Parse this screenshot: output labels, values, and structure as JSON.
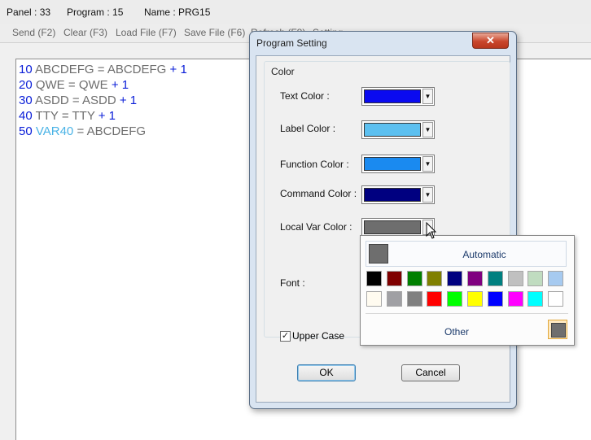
{
  "status": {
    "panel": "Panel : 33",
    "program": "Program : 15",
    "name": "Name : PRG15"
  },
  "toolbar": {
    "send": "Send (F2)",
    "clear": "Clear (F3)",
    "load": "Load File (F7)",
    "save": "Save File (F6)",
    "refresh": "Refresh (F8)",
    "setting": "Setting"
  },
  "code": {
    "line1": {
      "num": "10",
      "var": "ABCDEFG",
      "eq": "=",
      "val": "ABCDEFG",
      "op": "+",
      "num2": "1"
    },
    "line2": {
      "num": "20",
      "var": "QWE",
      "eq": "=",
      "val": "QWE",
      "op": "+",
      "num2": "1"
    },
    "line3": {
      "num": "30",
      "var": "ASDD",
      "eq": "=",
      "val": "ASDD",
      "op": "+",
      "num2": "1"
    },
    "line4": {
      "num": "40",
      "var": "TTY",
      "eq": "=",
      "val": "TTY",
      "op": "+",
      "num2": "1"
    },
    "line5": {
      "num": "50",
      "var": "VAR40",
      "eq": "=",
      "val": "ABCDEFG"
    }
  },
  "dialog": {
    "title": "Program Setting",
    "close": "✕",
    "group_title": "Color",
    "fields": [
      {
        "label": "Text Color :",
        "color": "#0a0af0"
      },
      {
        "label": "Label Color :",
        "color": "#5cc0f0"
      },
      {
        "label": "Function Color :",
        "color": "#1a8af0"
      },
      {
        "label": "Command Color :",
        "color": "#000080"
      },
      {
        "label": "Local Var Color :",
        "color": "#6e6e6e"
      }
    ],
    "font_label": "Font :",
    "uppercase_label": "Upper Case",
    "uppercase_checked": true,
    "ok": "OK",
    "cancel": "Cancel"
  },
  "popup": {
    "automatic": "Automatic",
    "other": "Other",
    "palette_row1": [
      "#000000",
      "#800000",
      "#008000",
      "#808000",
      "#000080",
      "#800080",
      "#008080",
      "#c0c0c0",
      "#c0dcc0",
      "#a6caf0"
    ],
    "palette_row2": [
      "#fffbf0",
      "#a0a0a4",
      "#808080",
      "#ff0000",
      "#00ff00",
      "#ffff00",
      "#0000ff",
      "#ff00ff",
      "#00ffff",
      "#ffffff"
    ]
  }
}
